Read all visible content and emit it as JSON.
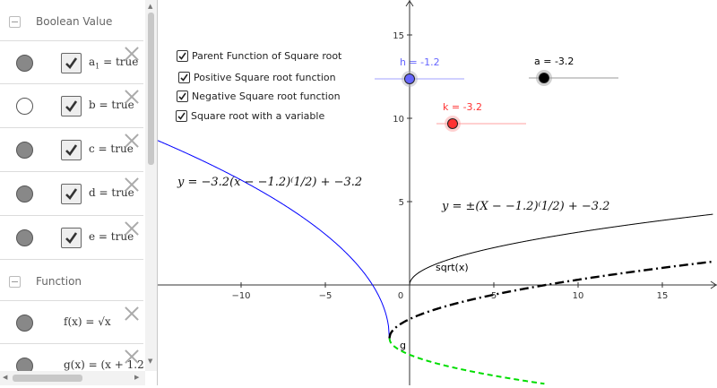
{
  "algebra": {
    "sections": [
      {
        "title": "Boolean Value"
      },
      {
        "title": "Function"
      }
    ],
    "booleans": [
      {
        "name": "a",
        "sub": "1",
        "value": "true",
        "visible": true
      },
      {
        "name": "b",
        "sub": "",
        "value": "true",
        "visible": false
      },
      {
        "name": "c",
        "sub": "",
        "value": "true",
        "visible": true
      },
      {
        "name": "d",
        "sub": "",
        "value": "true",
        "visible": true
      },
      {
        "name": "e",
        "sub": "",
        "value": "true",
        "visible": true
      }
    ],
    "functions": [
      {
        "label": "f(x)  =  √x"
      },
      {
        "label": "g(x)  =  (x + 1.2"
      }
    ]
  },
  "graphics": {
    "checkboxes": [
      {
        "label": "Parent Function of Square root",
        "checked": true
      },
      {
        "label": "Positive Square root function",
        "checked": true
      },
      {
        "label": "Negative Square root function",
        "checked": true
      },
      {
        "label": "Square root with a variable",
        "checked": true
      }
    ],
    "formula_left": "y = −3.2(x − −1.2)⁽1/2) + −3.2",
    "formula_right": "y = ±(X − −1.2)⁽1/2) + −3.2",
    "sliders": [
      {
        "name": "h",
        "label": "h = -1.2",
        "color": "#6666ff"
      },
      {
        "name": "a",
        "label": "a = -3.2",
        "color": "#000000"
      },
      {
        "name": "k",
        "label": "k = -3.2",
        "color": "#ff3333"
      }
    ],
    "curve_labels": {
      "sqrt": "sqrt(x)",
      "g": "g"
    },
    "x_ticks": [
      "−10",
      "−5",
      "0",
      "5",
      "10",
      "15"
    ],
    "y_ticks": [
      "15",
      "10",
      "5"
    ],
    "parameters": {
      "h": -1.2,
      "a": -3.2,
      "k": -3.2
    },
    "colors": {
      "positive": "#0000ff",
      "negative": "#00dd00",
      "parent": "#000000",
      "variable": "#000000"
    }
  }
}
